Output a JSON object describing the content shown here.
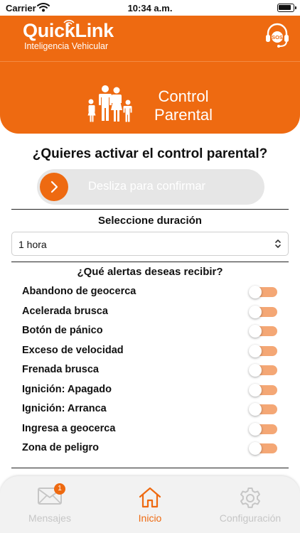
{
  "status_bar": {
    "carrier": "Carrier",
    "time": "10:34 a.m."
  },
  "header": {
    "brand": "QuickLink",
    "tagline": "Inteligencia Vehicular",
    "sos_label": "SOS"
  },
  "hero": {
    "title_line1": "Control",
    "title_line2": "Parental"
  },
  "activation": {
    "question": "¿Quieres activar el control parental?",
    "slide_text": "Desliza para confirmar"
  },
  "duration": {
    "label": "Seleccione duración",
    "selected": "1 hora"
  },
  "alerts": {
    "title": "¿Qué alertas deseas recibir?",
    "items": [
      {
        "label": "Abandono de geocerca",
        "enabled": false
      },
      {
        "label": "Acelerada brusca",
        "enabled": false
      },
      {
        "label": "Botón de pánico",
        "enabled": false
      },
      {
        "label": "Exceso de velocidad",
        "enabled": false
      },
      {
        "label": "Frenada brusca",
        "enabled": false
      },
      {
        "label": "Ignición: Apagado",
        "enabled": false
      },
      {
        "label": "Ignición: Arranca",
        "enabled": false
      },
      {
        "label": "Ingresa a geocerca",
        "enabled": false
      },
      {
        "label": "Zona de peligro",
        "enabled": false
      }
    ]
  },
  "tabbar": {
    "tabs": [
      {
        "label": "Mensajes",
        "icon": "envelope-icon",
        "badge": "1"
      },
      {
        "label": "Inicio",
        "icon": "home-icon",
        "active": true
      },
      {
        "label": "Configuración",
        "icon": "gear-icon"
      }
    ]
  },
  "colors": {
    "accent": "#ee6a11",
    "toggle_track": "#f4a775",
    "slider_track": "#e6e6e6",
    "tab_inactive": "#c6c6c6"
  }
}
